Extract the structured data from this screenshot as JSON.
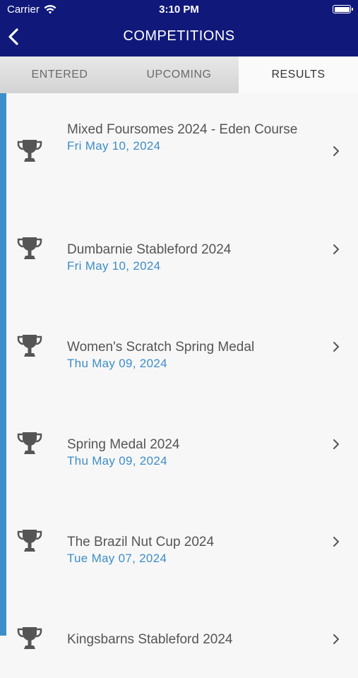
{
  "status_bar": {
    "carrier": "Carrier",
    "time": "3:10 PM"
  },
  "header": {
    "title": "COMPETITIONS"
  },
  "tabs": [
    {
      "label": "ENTERED",
      "active": false
    },
    {
      "label": "UPCOMING",
      "active": false
    },
    {
      "label": "RESULTS",
      "active": true
    }
  ],
  "colors": {
    "header_bg": "#10197a",
    "accent": "#3d8ec9",
    "date_text": "#3d8ec9"
  },
  "competitions": [
    {
      "name": "Mixed Foursomes 2024 - Eden Course",
      "date": "Fri May 10, 2024",
      "icon": "trophy-icon"
    },
    {
      "name": "Dumbarnie Stableford 2024",
      "date": "Fri May 10, 2024",
      "icon": "trophy-icon"
    },
    {
      "name": "Women's Scratch Spring Medal",
      "date": "Thu May 09, 2024",
      "icon": "trophy-icon"
    },
    {
      "name": "Spring Medal 2024",
      "date": "Thu May 09, 2024",
      "icon": "trophy-icon"
    },
    {
      "name": "The Brazil Nut Cup 2024",
      "date": "Tue May 07, 2024",
      "icon": "trophy-icon"
    },
    {
      "name": "Kingsbarns Stableford 2024",
      "date": "",
      "icon": "trophy-icon"
    }
  ]
}
